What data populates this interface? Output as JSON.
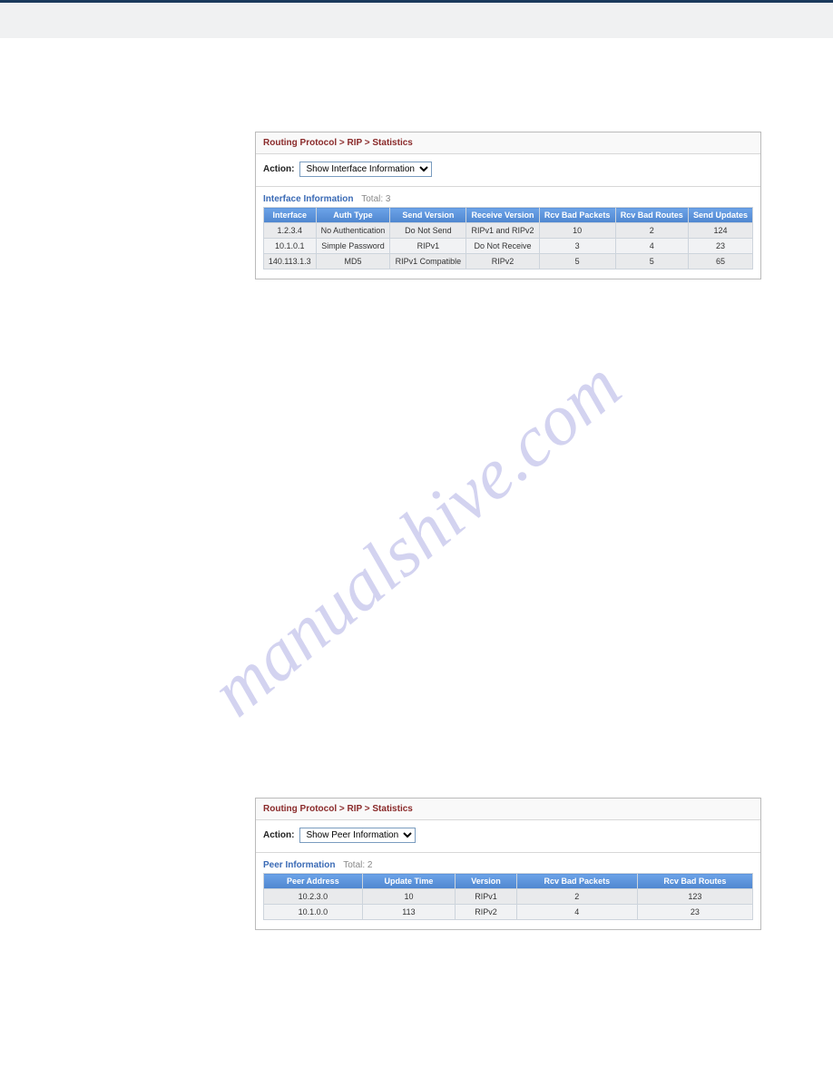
{
  "watermark": "manualshive.com",
  "panel1": {
    "breadcrumb": "Routing Protocol > RIP > Statistics",
    "action_label": "Action:",
    "action_selected": "Show Interface Information",
    "section_title": "Interface Information",
    "section_total": "Total: 3",
    "headers": [
      "Interface",
      "Auth Type",
      "Send Version",
      "Receive Version",
      "Rcv Bad Packets",
      "Rcv Bad Routes",
      "Send Updates"
    ],
    "rows": [
      [
        "1.2.3.4",
        "No Authentication",
        "Do Not Send",
        "RIPv1 and RIPv2",
        "10",
        "2",
        "124"
      ],
      [
        "10.1.0.1",
        "Simple Password",
        "RIPv1",
        "Do Not Receive",
        "3",
        "4",
        "23"
      ],
      [
        "140.113.1.3",
        "MD5",
        "RIPv1 Compatible",
        "RIPv2",
        "5",
        "5",
        "65"
      ]
    ]
  },
  "panel2": {
    "breadcrumb": "Routing Protocol > RIP > Statistics",
    "action_label": "Action:",
    "action_selected": "Show Peer Information",
    "section_title": "Peer Information",
    "section_total": "Total: 2",
    "headers": [
      "Peer Address",
      "Update Time",
      "Version",
      "Rcv Bad Packets",
      "Rcv Bad Routes"
    ],
    "rows": [
      [
        "10.2.3.0",
        "10",
        "RIPv1",
        "2",
        "123"
      ],
      [
        "10.1.0.0",
        "113",
        "RIPv2",
        "4",
        "23"
      ]
    ]
  }
}
